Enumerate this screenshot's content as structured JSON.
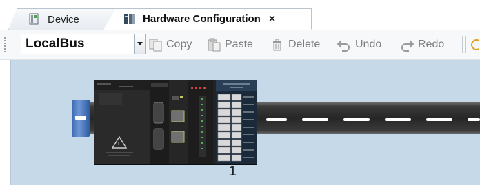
{
  "tabs": [
    {
      "label": "Device",
      "icon": "device-icon",
      "active": false
    },
    {
      "label": "Hardware Configuration",
      "icon": "hardware-config-icon",
      "active": true,
      "close": "×"
    }
  ],
  "toolbar": {
    "bus_select": {
      "value": "LocalBus"
    },
    "copy_label": "Copy",
    "paste_label": "Paste",
    "delete_label": "Delete",
    "undo_label": "Undo",
    "redo_label": "Redo"
  },
  "canvas": {
    "module_number": "1"
  },
  "colors": {
    "canvas_bg": "#c5d9e8",
    "rail_end": "#3a68b0",
    "rail": "#262626"
  }
}
